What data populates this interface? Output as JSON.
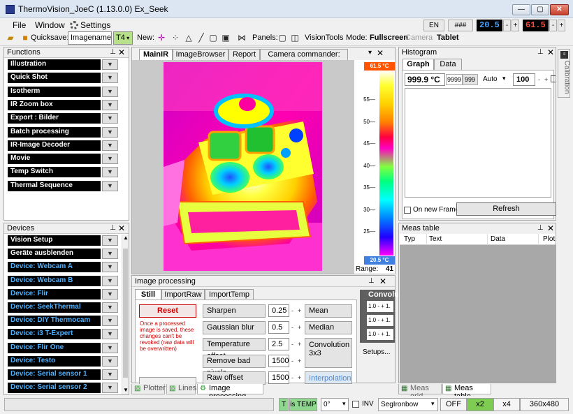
{
  "window": {
    "title": "ThermoVision_JoeC (1.13.0.0) Ex_Seek",
    "min": "—",
    "max": "▢",
    "close": "✕"
  },
  "menu": {
    "file": "File",
    "window": "Window",
    "settings": "Settings"
  },
  "toolbar": {
    "quicksave_label": "Quicksave:",
    "quicksave_value": "Imagename",
    "t4": "T4",
    "new_label": "New:",
    "panels_label": "Panels:",
    "visiontools": "VisionTools",
    "mode_label": "Mode:",
    "fullscreen": "Fullscreen",
    "camera": "Camera",
    "tablet": "Tablet",
    "lang": "EN",
    "hash": "###",
    "temp_low": "20.5",
    "temp_high": "61.5",
    "minus": "-",
    "plus": "+"
  },
  "functions": {
    "title": "Functions",
    "items": [
      "Illustration",
      "Quick Shot",
      "Isotherm",
      "IR Zoom box",
      "Export : Bilder",
      "Batch processing",
      "IR-Image Decoder",
      "Movie",
      "Temp Switch",
      "Thermal Sequence"
    ]
  },
  "devices": {
    "title": "Devices",
    "items": [
      "Vision Setup",
      "Geräte ausblenden",
      "Device: Webcam A",
      "Device: Webcam B",
      "Device: Flir",
      "Device: SeekThermal",
      "Device: DIY Thermocam",
      "Device: i3 T-Expert",
      "Device: Flir One",
      "Device: Testo",
      "Device: Serial sensor 1",
      "Device: Serial sensor 2"
    ]
  },
  "main_tabs": [
    "MainIR",
    "ImageBrowser",
    "Report",
    "Camera commander: FLIR"
  ],
  "scale": {
    "max": "61.5 °C",
    "min": "20.5 °C",
    "ticks": [
      "55",
      "50",
      "45",
      "40",
      "35",
      "30",
      "25"
    ],
    "range_label": "Range:",
    "range_value": "41"
  },
  "image_processing": {
    "title": "Image processing",
    "tabs": [
      "Still",
      "ImportRaw",
      "ImportTemp"
    ],
    "reset": "Reset",
    "note": "Once a processed image is saved, these changes can't be revoked (raw data will be overwritten)",
    "rows": [
      {
        "label": "Sharpen",
        "value": "0.25"
      },
      {
        "label": "Gaussian blur",
        "value": "0.5"
      },
      {
        "label": "Temperature offset",
        "value": "2.5"
      },
      {
        "label": "Remove bad pixels",
        "value": "1500"
      },
      {
        "label": "Raw offset",
        "value": "1500"
      }
    ],
    "right_buttons": [
      "Mean",
      "Median",
      "Convolution 3x3",
      "Interpolation"
    ],
    "convolution_title": "Convolu",
    "conv_values": [
      "1.0",
      "1.0",
      "1.0"
    ],
    "setups": "Setups..."
  },
  "bottom_tabs": [
    "Plotter",
    "Lines",
    "Image processing"
  ],
  "histogram": {
    "title": "Histogram",
    "tabs": [
      "Graph",
      "Data"
    ],
    "value": "999.9 °C",
    "v1": "9999",
    "v2": "999",
    "auto": "Auto",
    "count": "100",
    "on_new_frame": "On new Frame",
    "refresh": "Refresh",
    "side_tab": "Calibration"
  },
  "meas_table": {
    "title": "Meas table",
    "columns": [
      "Typ",
      "Text",
      "Data",
      "Plot"
    ],
    "bottom_tabs": [
      "Meas grid",
      "Meas table"
    ]
  },
  "status": {
    "t": "T",
    "is_temp": "is TEMP",
    "angle": "0°",
    "inv": "INV",
    "palette": "SegIronbow",
    "off": "OFF",
    "x2": "x2",
    "x4": "x4",
    "resolution": "360x480"
  }
}
